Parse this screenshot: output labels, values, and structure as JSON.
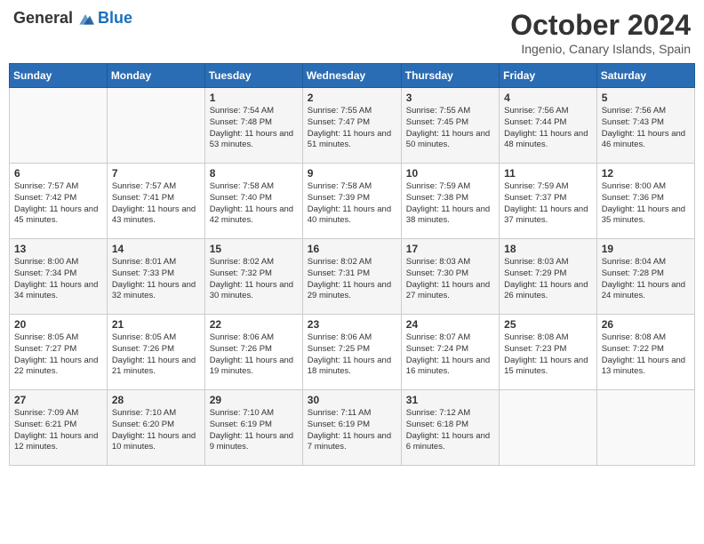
{
  "header": {
    "logo_general": "General",
    "logo_blue": "Blue",
    "month": "October 2024",
    "location": "Ingenio, Canary Islands, Spain"
  },
  "days_of_week": [
    "Sunday",
    "Monday",
    "Tuesday",
    "Wednesday",
    "Thursday",
    "Friday",
    "Saturday"
  ],
  "weeks": [
    [
      {
        "day": "",
        "info": ""
      },
      {
        "day": "",
        "info": ""
      },
      {
        "day": "1",
        "info": "Sunrise: 7:54 AM\nSunset: 7:48 PM\nDaylight: 11 hours and 53 minutes."
      },
      {
        "day": "2",
        "info": "Sunrise: 7:55 AM\nSunset: 7:47 PM\nDaylight: 11 hours and 51 minutes."
      },
      {
        "day": "3",
        "info": "Sunrise: 7:55 AM\nSunset: 7:45 PM\nDaylight: 11 hours and 50 minutes."
      },
      {
        "day": "4",
        "info": "Sunrise: 7:56 AM\nSunset: 7:44 PM\nDaylight: 11 hours and 48 minutes."
      },
      {
        "day": "5",
        "info": "Sunrise: 7:56 AM\nSunset: 7:43 PM\nDaylight: 11 hours and 46 minutes."
      }
    ],
    [
      {
        "day": "6",
        "info": "Sunrise: 7:57 AM\nSunset: 7:42 PM\nDaylight: 11 hours and 45 minutes."
      },
      {
        "day": "7",
        "info": "Sunrise: 7:57 AM\nSunset: 7:41 PM\nDaylight: 11 hours and 43 minutes."
      },
      {
        "day": "8",
        "info": "Sunrise: 7:58 AM\nSunset: 7:40 PM\nDaylight: 11 hours and 42 minutes."
      },
      {
        "day": "9",
        "info": "Sunrise: 7:58 AM\nSunset: 7:39 PM\nDaylight: 11 hours and 40 minutes."
      },
      {
        "day": "10",
        "info": "Sunrise: 7:59 AM\nSunset: 7:38 PM\nDaylight: 11 hours and 38 minutes."
      },
      {
        "day": "11",
        "info": "Sunrise: 7:59 AM\nSunset: 7:37 PM\nDaylight: 11 hours and 37 minutes."
      },
      {
        "day": "12",
        "info": "Sunrise: 8:00 AM\nSunset: 7:36 PM\nDaylight: 11 hours and 35 minutes."
      }
    ],
    [
      {
        "day": "13",
        "info": "Sunrise: 8:00 AM\nSunset: 7:34 PM\nDaylight: 11 hours and 34 minutes."
      },
      {
        "day": "14",
        "info": "Sunrise: 8:01 AM\nSunset: 7:33 PM\nDaylight: 11 hours and 32 minutes."
      },
      {
        "day": "15",
        "info": "Sunrise: 8:02 AM\nSunset: 7:32 PM\nDaylight: 11 hours and 30 minutes."
      },
      {
        "day": "16",
        "info": "Sunrise: 8:02 AM\nSunset: 7:31 PM\nDaylight: 11 hours and 29 minutes."
      },
      {
        "day": "17",
        "info": "Sunrise: 8:03 AM\nSunset: 7:30 PM\nDaylight: 11 hours and 27 minutes."
      },
      {
        "day": "18",
        "info": "Sunrise: 8:03 AM\nSunset: 7:29 PM\nDaylight: 11 hours and 26 minutes."
      },
      {
        "day": "19",
        "info": "Sunrise: 8:04 AM\nSunset: 7:28 PM\nDaylight: 11 hours and 24 minutes."
      }
    ],
    [
      {
        "day": "20",
        "info": "Sunrise: 8:05 AM\nSunset: 7:27 PM\nDaylight: 11 hours and 22 minutes."
      },
      {
        "day": "21",
        "info": "Sunrise: 8:05 AM\nSunset: 7:26 PM\nDaylight: 11 hours and 21 minutes."
      },
      {
        "day": "22",
        "info": "Sunrise: 8:06 AM\nSunset: 7:26 PM\nDaylight: 11 hours and 19 minutes."
      },
      {
        "day": "23",
        "info": "Sunrise: 8:06 AM\nSunset: 7:25 PM\nDaylight: 11 hours and 18 minutes."
      },
      {
        "day": "24",
        "info": "Sunrise: 8:07 AM\nSunset: 7:24 PM\nDaylight: 11 hours and 16 minutes."
      },
      {
        "day": "25",
        "info": "Sunrise: 8:08 AM\nSunset: 7:23 PM\nDaylight: 11 hours and 15 minutes."
      },
      {
        "day": "26",
        "info": "Sunrise: 8:08 AM\nSunset: 7:22 PM\nDaylight: 11 hours and 13 minutes."
      }
    ],
    [
      {
        "day": "27",
        "info": "Sunrise: 7:09 AM\nSunset: 6:21 PM\nDaylight: 11 hours and 12 minutes."
      },
      {
        "day": "28",
        "info": "Sunrise: 7:10 AM\nSunset: 6:20 PM\nDaylight: 11 hours and 10 minutes."
      },
      {
        "day": "29",
        "info": "Sunrise: 7:10 AM\nSunset: 6:19 PM\nDaylight: 11 hours and 9 minutes."
      },
      {
        "day": "30",
        "info": "Sunrise: 7:11 AM\nSunset: 6:19 PM\nDaylight: 11 hours and 7 minutes."
      },
      {
        "day": "31",
        "info": "Sunrise: 7:12 AM\nSunset: 6:18 PM\nDaylight: 11 hours and 6 minutes."
      },
      {
        "day": "",
        "info": ""
      },
      {
        "day": "",
        "info": ""
      }
    ]
  ]
}
